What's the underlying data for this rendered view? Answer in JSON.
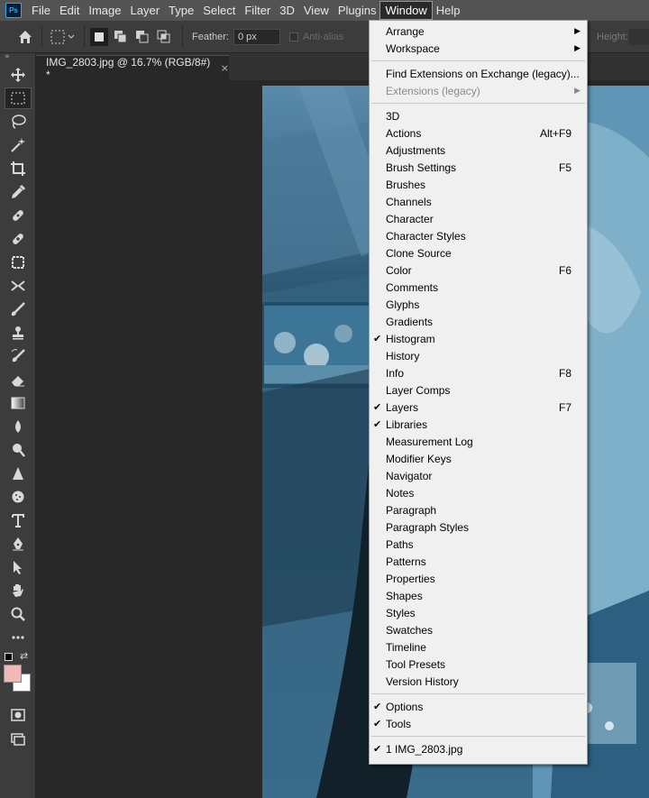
{
  "menubar": {
    "logo": "Ps",
    "items": [
      "File",
      "Edit",
      "Image",
      "Layer",
      "Type",
      "Select",
      "Filter",
      "3D",
      "View",
      "Plugins",
      "Window",
      "Help"
    ],
    "active": "Window"
  },
  "options": {
    "feather_label": "Feather:",
    "feather_value": "0 px",
    "antialias_label": "Anti-alias",
    "height_label": "Height:"
  },
  "toolbar": {
    "collapse": "»",
    "tools": [
      "move-tool",
      "marquee-tool",
      "lasso-tool",
      "magic-wand-tool",
      "crop-tool",
      "eyedropper-tool",
      "spot-healing-tool",
      "brush-tool",
      "clone-stamp-tool",
      "history-brush-tool",
      "eraser-tool",
      "gradient-tool",
      "blur-tool",
      "dodge-tool",
      "pen-tool",
      "type-tool",
      "path-selection-tool",
      "hand-tool",
      "zoom-tool",
      "more-tools"
    ],
    "foreground_color": "#f2b8b8",
    "background_color": "#ffffff"
  },
  "document": {
    "tab_title": "IMG_2803.jpg @ 16.7% (RGB/8#) *",
    "close": "×"
  },
  "window_menu": {
    "group1": [
      {
        "label": "Arrange",
        "submenu": true
      },
      {
        "label": "Workspace",
        "submenu": true
      }
    ],
    "group2": [
      {
        "label": "Find Extensions on Exchange (legacy)..."
      },
      {
        "label": "Extensions (legacy)",
        "submenu": true,
        "disabled": true
      }
    ],
    "group3": [
      {
        "label": "3D"
      },
      {
        "label": "Actions",
        "shortcut": "Alt+F9"
      },
      {
        "label": "Adjustments"
      },
      {
        "label": "Brush Settings",
        "shortcut": "F5"
      },
      {
        "label": "Brushes"
      },
      {
        "label": "Channels"
      },
      {
        "label": "Character"
      },
      {
        "label": "Character Styles"
      },
      {
        "label": "Clone Source"
      },
      {
        "label": "Color",
        "shortcut": "F6"
      },
      {
        "label": "Comments"
      },
      {
        "label": "Glyphs"
      },
      {
        "label": "Gradients"
      },
      {
        "label": "Histogram",
        "checked": true
      },
      {
        "label": "History"
      },
      {
        "label": "Info",
        "shortcut": "F8"
      },
      {
        "label": "Layer Comps"
      },
      {
        "label": "Layers",
        "shortcut": "F7",
        "checked": true
      },
      {
        "label": "Libraries",
        "checked": true
      },
      {
        "label": "Measurement Log"
      },
      {
        "label": "Modifier Keys"
      },
      {
        "label": "Navigator"
      },
      {
        "label": "Notes"
      },
      {
        "label": "Paragraph"
      },
      {
        "label": "Paragraph Styles"
      },
      {
        "label": "Paths"
      },
      {
        "label": "Patterns"
      },
      {
        "label": "Properties"
      },
      {
        "label": "Shapes"
      },
      {
        "label": "Styles"
      },
      {
        "label": "Swatches"
      },
      {
        "label": "Timeline"
      },
      {
        "label": "Tool Presets"
      },
      {
        "label": "Version History"
      }
    ],
    "group4": [
      {
        "label": "Options",
        "checked": true
      },
      {
        "label": "Tools",
        "checked": true
      }
    ],
    "group5": [
      {
        "label": "1 IMG_2803.jpg",
        "checked": true
      }
    ],
    "check_glyph": "✔",
    "submenu_glyph": "▶"
  },
  "colors": {
    "menubar_bg": "#535353",
    "panel_bg": "#3c3c3c",
    "canvas_bg": "#282828",
    "menu_bg": "#f0f0f0"
  }
}
